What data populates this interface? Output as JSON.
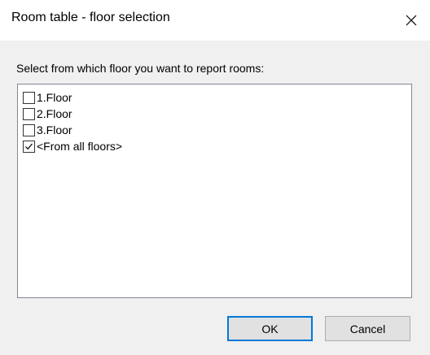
{
  "window": {
    "title": "Room table - floor selection",
    "close_icon": "close-icon"
  },
  "instruction": "Select from which floor you want to report rooms:",
  "floors": [
    {
      "label": "1.Floor",
      "checked": false
    },
    {
      "label": "2.Floor",
      "checked": false
    },
    {
      "label": "3.Floor",
      "checked": false
    },
    {
      "label": "<From all floors>",
      "checked": true
    }
  ],
  "buttons": {
    "ok_label": "OK",
    "cancel_label": "Cancel"
  },
  "colors": {
    "dialog_bg": "#f0f0f0",
    "titlebar_bg": "#ffffff",
    "default_button_border": "#0078d7"
  }
}
